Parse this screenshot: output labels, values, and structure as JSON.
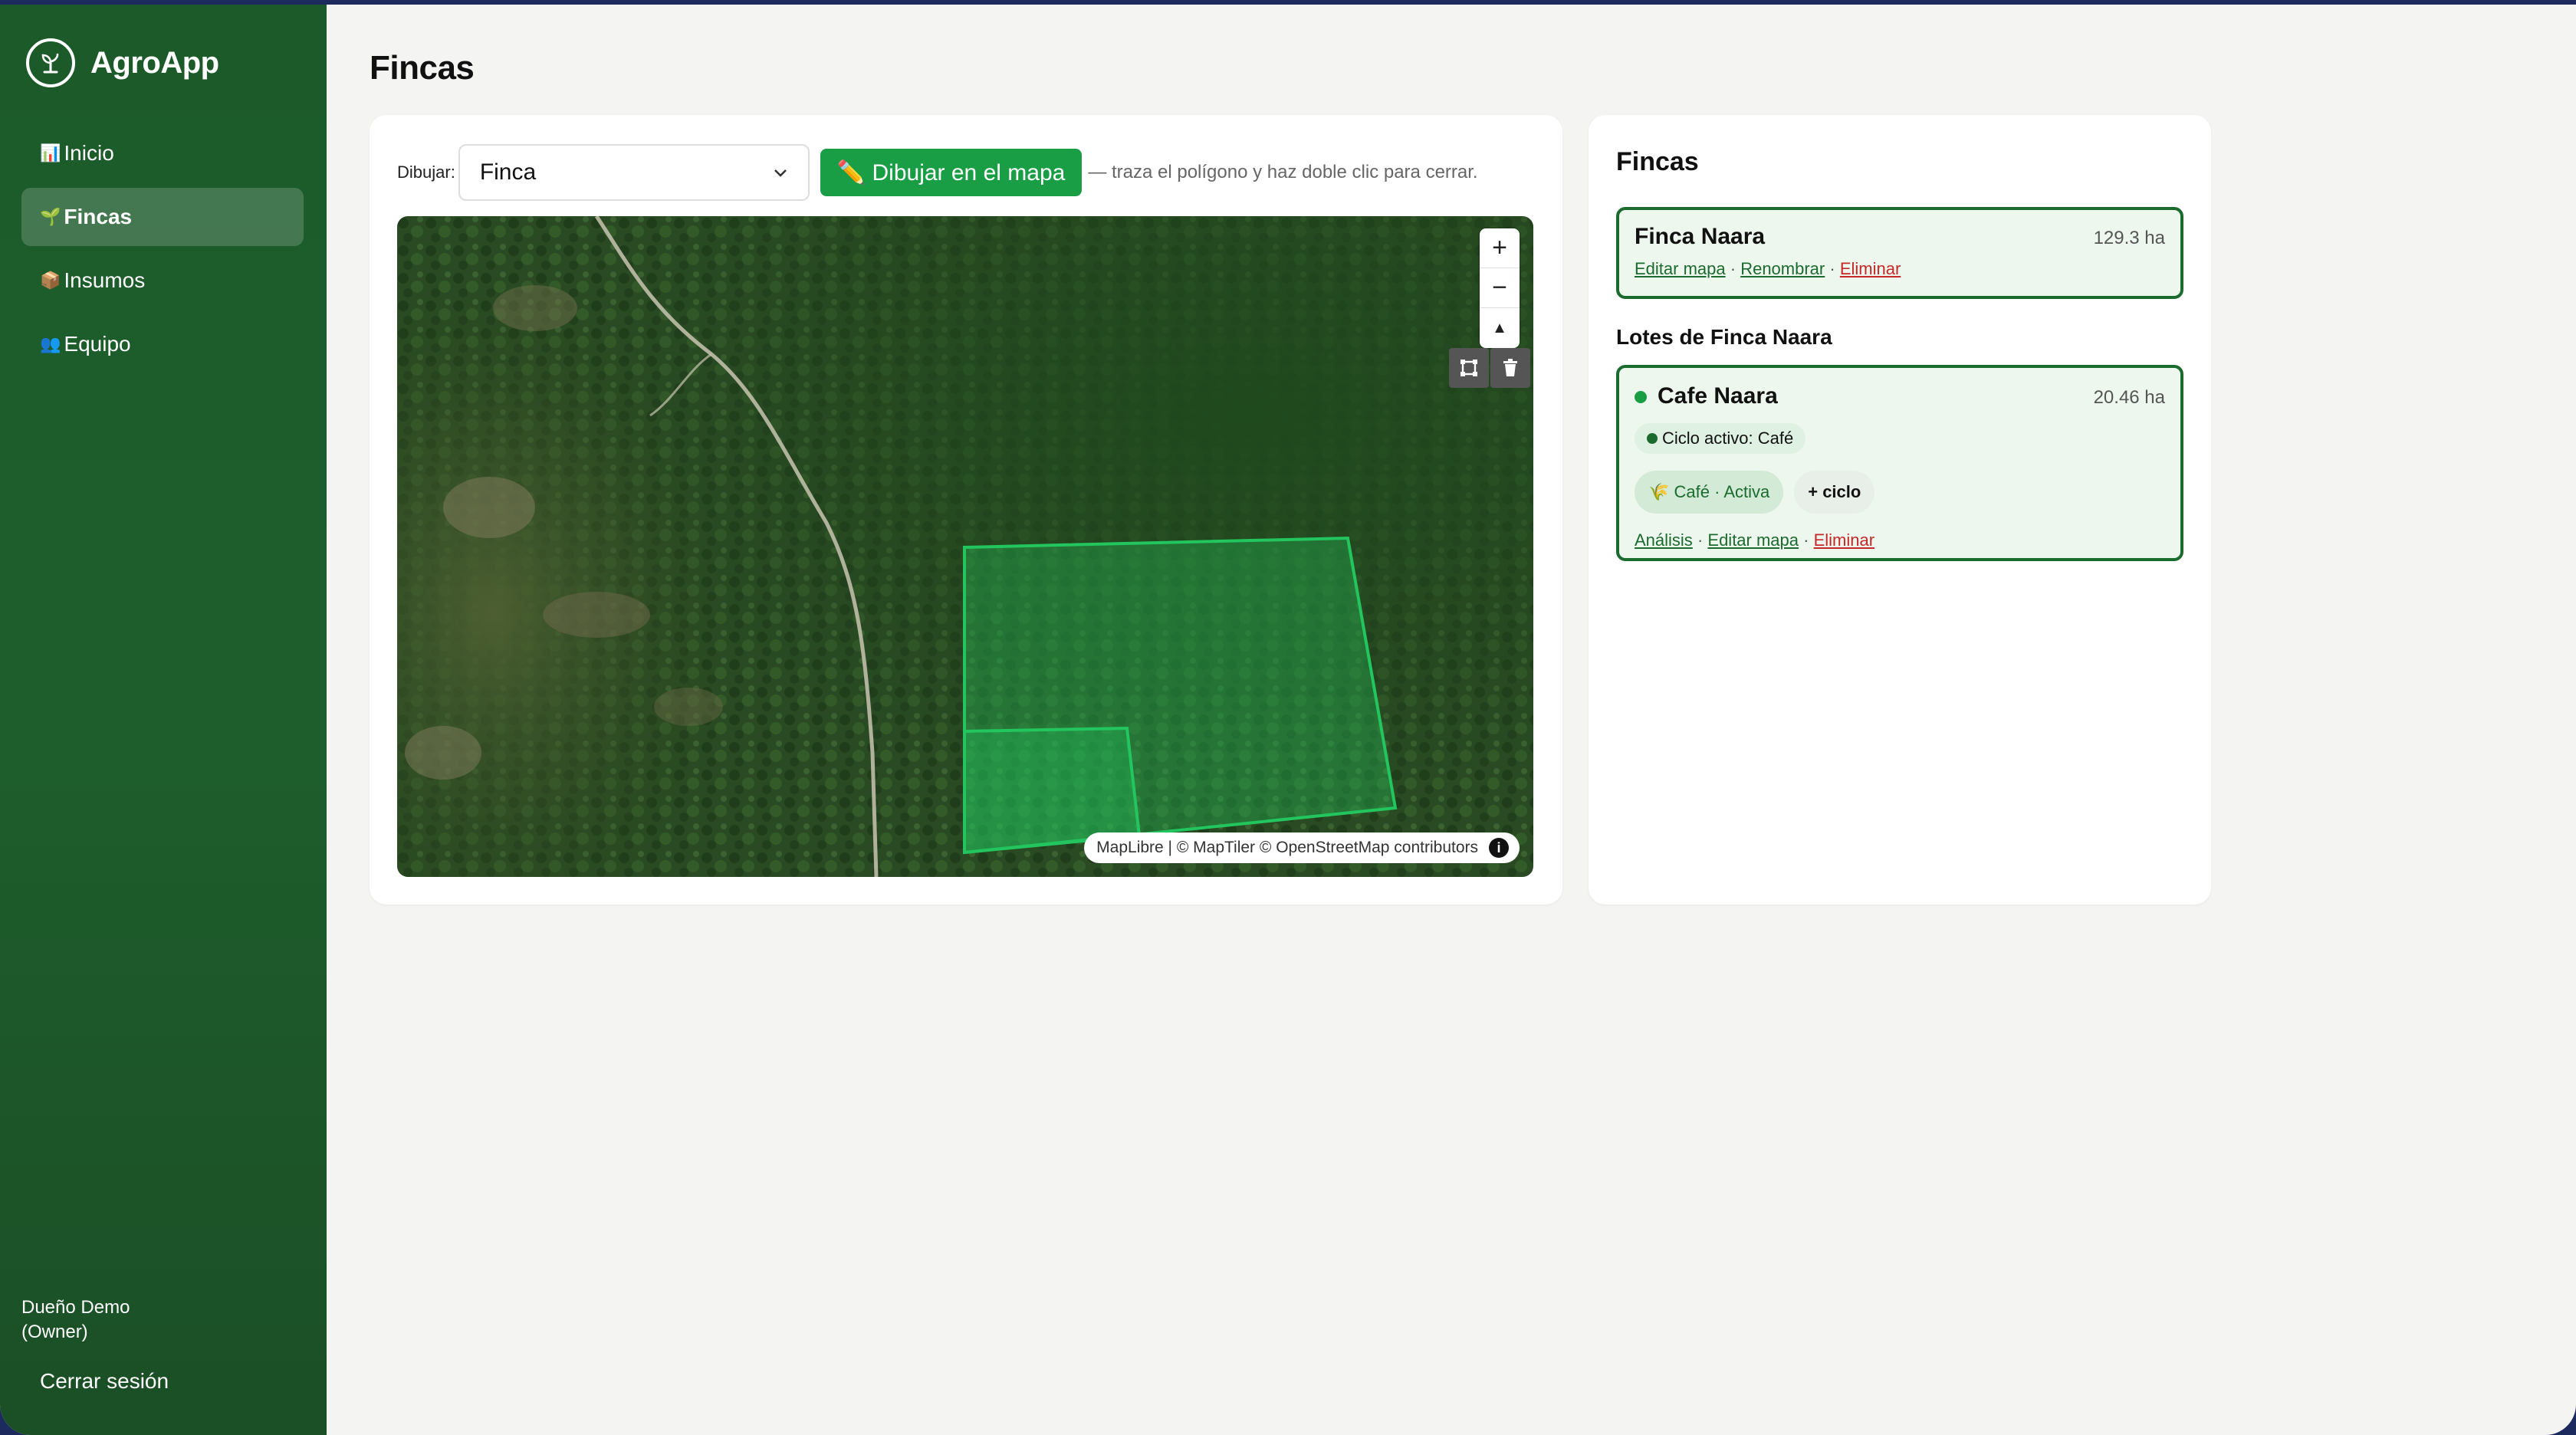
{
  "app": {
    "name": "AgroApp"
  },
  "nav": {
    "items": [
      {
        "icon": "📊",
        "label": "Inicio"
      },
      {
        "icon": "🌱",
        "label": "Fincas"
      },
      {
        "icon": "📦",
        "label": "Insumos"
      },
      {
        "icon": "👥",
        "label": "Equipo"
      }
    ]
  },
  "user": {
    "name": "Dueño Demo",
    "role": "(Owner)",
    "logout_label": "Cerrar sesión"
  },
  "page": {
    "title": "Fincas"
  },
  "draw": {
    "label": "Dibujar:",
    "selected": "Finca",
    "button_label": "✏️ Dibujar en el mapa",
    "hint": "— traza el polígono y haz doble clic para cerrar."
  },
  "map": {
    "zoom_in": "+",
    "zoom_out": "−",
    "compass": "▲",
    "attribution": "MapLibre | © MapTiler © OpenStreetMap contributors",
    "info": "i"
  },
  "list": {
    "title": "Fincas",
    "farm": {
      "name": "Finca Naara",
      "size": "129.3 ha",
      "link_edit_map": "Editar mapa",
      "link_rename": "Renombrar",
      "link_delete": "Eliminar",
      "separator": "·"
    },
    "lots_title": "Lotes de Finca Naara",
    "lot": {
      "name": "Cafe Naara",
      "size": "20.46 ha",
      "status_color": "#1a9e45",
      "cycle_badge": "Ciclo activo: Café",
      "chip_active": "🌾 Café · Activa",
      "chip_add": "+ ciclo",
      "link_analysis": "Análisis",
      "link_edit_map": "Editar mapa",
      "link_delete": "Eliminar",
      "separator": "·"
    }
  },
  "colors": {
    "accent": "#1a9e45",
    "sidebar": "#1c5a2a",
    "danger": "#c62828"
  }
}
